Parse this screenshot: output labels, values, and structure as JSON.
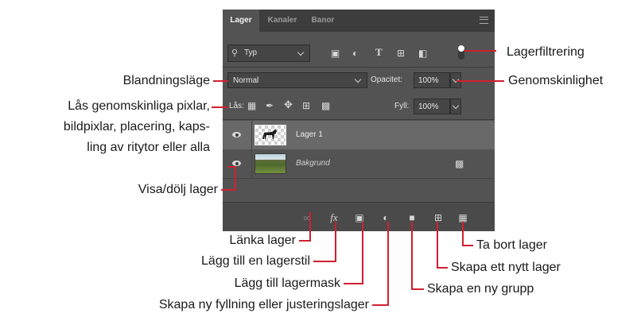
{
  "panel": {
    "tabs": [
      {
        "label": "Lager",
        "active": true
      },
      {
        "label": "Kanaler",
        "active": false
      },
      {
        "label": "Banor",
        "active": false
      }
    ],
    "filter": {
      "kind_value": "Typ"
    },
    "blend": {
      "mode_value": "Normal",
      "opacity_label": "Opacitet:",
      "opacity_value": "100%"
    },
    "lock": {
      "label": "Lås:",
      "fill_label": "Fyll:",
      "fill_value": "100%"
    },
    "layers": [
      {
        "name": "Lager 1",
        "selected": true
      },
      {
        "name": "Bakgrund",
        "selected": false,
        "locked": true
      }
    ]
  },
  "callouts": {
    "filter": "Lagerfiltrering",
    "opacity": "Genomskinlighet",
    "blend": "Blandningsläge",
    "lock": [
      "Lås genomskinliga pixlar,",
      "bildpixlar, placering, kaps-",
      "ling av ritytor eller alla"
    ],
    "visibility": "Visa/dölj lager",
    "link": "Länka lager",
    "style": "Lägg till en lagerstil",
    "mask": "Lägg till lagermask",
    "adjust": "Skapa ny fyllning eller justeringslager",
    "delete": "Ta bort lager",
    "new_layer": "Skapa ett nytt lager",
    "new_group": "Skapa en ny grupp"
  },
  "colors": {
    "panel": "#535353",
    "tabbar": "#3d3d3d",
    "selected_row": "#696969",
    "leader": "#d0202f"
  }
}
